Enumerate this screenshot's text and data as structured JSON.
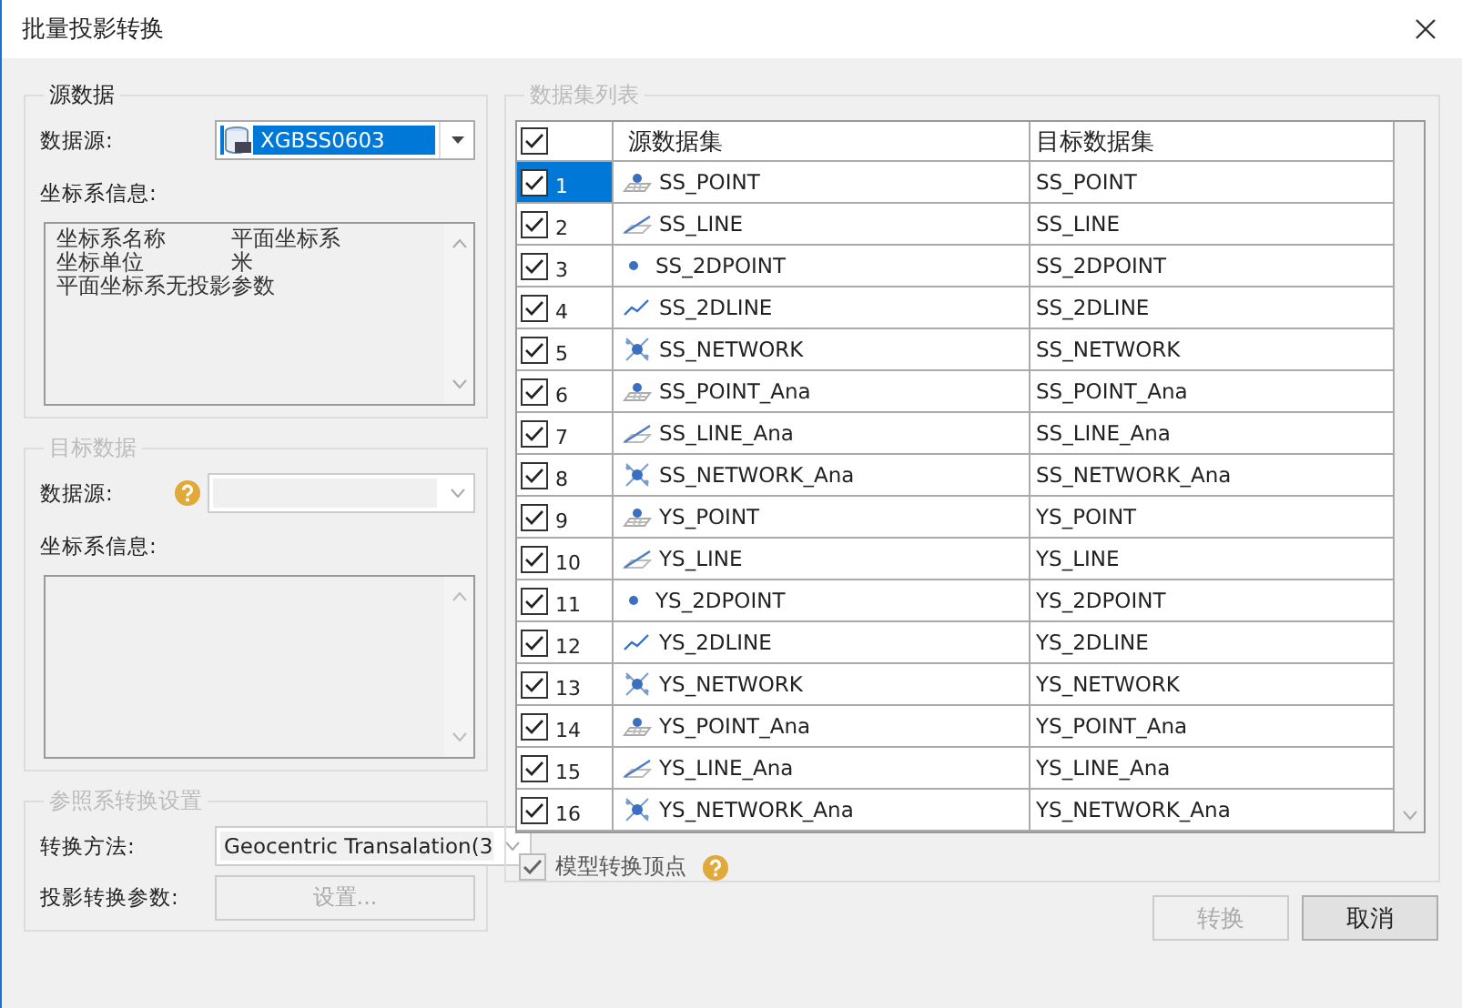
{
  "window": {
    "title": "批量投影转换"
  },
  "source": {
    "legend": "源数据",
    "datasource_label": "数据源:",
    "datasource": "XGBSS0603",
    "coord_label": "坐标系信息:",
    "coord_info": [
      {
        "name": "坐标系名称",
        "value": "平面坐标系"
      },
      {
        "name": "坐标单位",
        "value": "米"
      },
      {
        "name": "平面坐标系无投影参数"
      }
    ]
  },
  "target": {
    "legend": "目标数据",
    "datasource_label": "数据源:",
    "coord_label": "坐标系信息:"
  },
  "transform": {
    "legend": "参照系转换设置",
    "method_label": "转换方法:",
    "method": "Geocentric Transalation(3",
    "params_label": "投影转换参数:",
    "params_button": "设置..."
  },
  "datasets": {
    "legend": "数据集列表",
    "all_checked": true,
    "columns": [
      "源数据集",
      "目标数据集"
    ],
    "rows": [
      {
        "checked": true,
        "selected": true,
        "index": "1",
        "kind": "point",
        "source": "SS_POINT",
        "target": "SS_POINT"
      },
      {
        "checked": true,
        "selected": false,
        "index": "2",
        "kind": "line",
        "source": "SS_LINE",
        "target": "SS_LINE"
      },
      {
        "checked": true,
        "selected": false,
        "index": "3",
        "kind": "point2d",
        "source": "SS_2DPOINT",
        "target": "SS_2DPOINT"
      },
      {
        "checked": true,
        "selected": false,
        "index": "4",
        "kind": "line2d",
        "source": "SS_2DLINE",
        "target": "SS_2DLINE"
      },
      {
        "checked": true,
        "selected": false,
        "index": "5",
        "kind": "network",
        "source": "SS_NETWORK",
        "target": "SS_NETWORK"
      },
      {
        "checked": true,
        "selected": false,
        "index": "6",
        "kind": "point",
        "source": "SS_POINT_Ana",
        "target": "SS_POINT_Ana"
      },
      {
        "checked": true,
        "selected": false,
        "index": "7",
        "kind": "line",
        "source": "SS_LINE_Ana",
        "target": "SS_LINE_Ana"
      },
      {
        "checked": true,
        "selected": false,
        "index": "8",
        "kind": "network",
        "source": "SS_NETWORK_Ana",
        "target": "SS_NETWORK_Ana"
      },
      {
        "checked": true,
        "selected": false,
        "index": "9",
        "kind": "point",
        "source": "YS_POINT",
        "target": "YS_POINT"
      },
      {
        "checked": true,
        "selected": false,
        "index": "10",
        "kind": "line",
        "source": "YS_LINE",
        "target": "YS_LINE"
      },
      {
        "checked": true,
        "selected": false,
        "index": "11",
        "kind": "point2d",
        "source": "YS_2DPOINT",
        "target": "YS_2DPOINT"
      },
      {
        "checked": true,
        "selected": false,
        "index": "12",
        "kind": "line2d",
        "source": "YS_2DLINE",
        "target": "YS_2DLINE"
      },
      {
        "checked": true,
        "selected": false,
        "index": "13",
        "kind": "network",
        "source": "YS_NETWORK",
        "target": "YS_NETWORK"
      },
      {
        "checked": true,
        "selected": false,
        "index": "14",
        "kind": "point",
        "source": "YS_POINT_Ana",
        "target": "YS_POINT_Ana"
      },
      {
        "checked": true,
        "selected": false,
        "index": "15",
        "kind": "line",
        "source": "YS_LINE_Ana",
        "target": "YS_LINE_Ana"
      },
      {
        "checked": true,
        "selected": false,
        "index": "16",
        "kind": "network",
        "source": "YS_NETWORK_Ana",
        "target": "YS_NETWORK_Ana"
      }
    ]
  },
  "vertex_option": {
    "label": "模型转换顶点",
    "checked": true,
    "disabled": true
  },
  "buttons": [
    {
      "label": "转换",
      "disabled": true
    },
    {
      "label": "取消",
      "disabled": false
    }
  ]
}
